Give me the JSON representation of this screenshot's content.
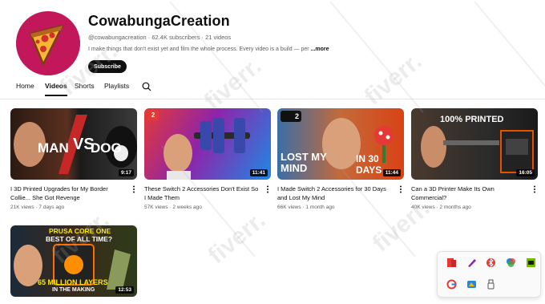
{
  "channel": {
    "name": "CowabungaCreation",
    "handle": "@cowabungacreation",
    "meta_separator": "·",
    "subscribers": "62.4K subscribers",
    "videos_count": "21 videos",
    "description": "I make things that don't exist yet and film the whole process. Every video is a build — per",
    "more_label": "...more",
    "subscribe_label": "Subscribe"
  },
  "tabs": [
    {
      "label": "Home",
      "active": false
    },
    {
      "label": "Videos",
      "active": true
    },
    {
      "label": "Shorts",
      "active": false
    },
    {
      "label": "Playlists",
      "active": false
    }
  ],
  "videos": [
    {
      "title": "I 3D Printed Upgrades for My Border Collie... She Got Revenge",
      "views": "21K views",
      "age": "7 days ago",
      "duration": "9:17",
      "overlay": {
        "line1": "MAN",
        "vs": "VS",
        "line2": "DOG"
      }
    },
    {
      "title": "These Switch 2 Accessories Don't Exist So I Made Them",
      "views": "57K views",
      "age": "2 weeks ago",
      "duration": "11:41",
      "overlay": {
        "badge": "2"
      }
    },
    {
      "title": "I Made Switch 2 Accessories for 30 Days and Lost My Mind",
      "views": "66K views",
      "age": "1 month ago",
      "duration": "11:44",
      "overlay": {
        "badge": "2",
        "line1": "LOST MY",
        "line2": "MIND",
        "line3": "IN 30 DAYS"
      }
    },
    {
      "title": "Can a 3D Printer Make Its Own Commercial?",
      "views": "40K views",
      "age": "2 months ago",
      "duration": "16:05",
      "overlay": {
        "line1": "100% PRINTED"
      }
    },
    {
      "title": "",
      "views": "",
      "age": "",
      "duration": "12:53",
      "overlay": {
        "line1": "PRUSA CORE ONE",
        "line2": "BEST OF ALL TIME?",
        "line3": "65 MILLION LAYERS",
        "line4": "IN THE MAKING"
      }
    }
  ],
  "watermark": "fiverr.",
  "colors": {
    "accent": "#0f0f0f",
    "meta": "#606060",
    "avatar_bg": "#c2185b",
    "cheese": "#f7b733",
    "pepperoni": "#d32f2f"
  },
  "tray_icons": [
    "red-app-icon",
    "purple-pen-icon",
    "bluetooth-icon",
    "color-picker-icon",
    "nvidia-icon",
    "google-icon",
    "onedrive-icon",
    "usb-icon"
  ]
}
